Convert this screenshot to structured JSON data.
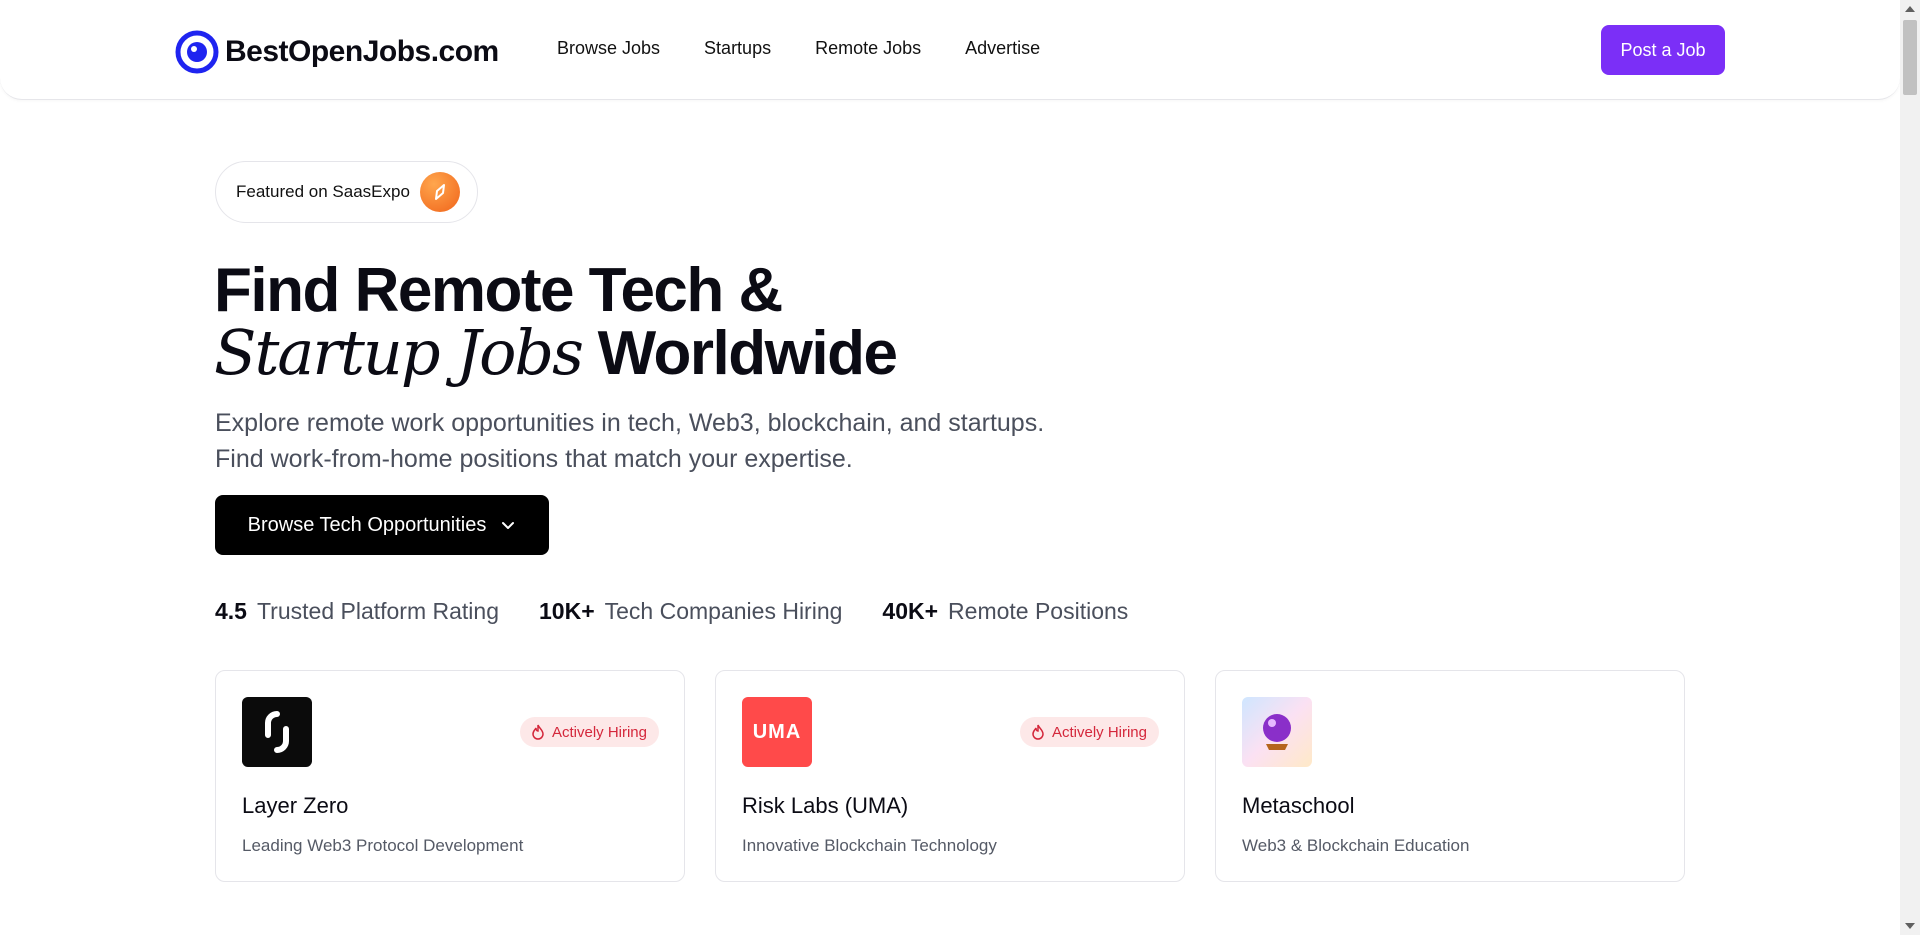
{
  "header": {
    "brand": "BestOpenJobs.com",
    "nav": [
      "Browse Jobs",
      "Startups",
      "Remote Jobs",
      "Advertise"
    ],
    "post_job": "Post a Job"
  },
  "featured": {
    "label": "Featured on SaasExpo"
  },
  "hero": {
    "title_line1": "Find Remote Tech &",
    "title_italic": "Startup Jobs",
    "title_line2_rest": " Worldwide",
    "subtitle_line1": "Explore remote work opportunities in tech, Web3, blockchain, and startups.",
    "subtitle_line2": "Find work-from-home positions that match your expertise.",
    "cta": "Browse Tech Opportunities"
  },
  "stats": [
    {
      "value": "4.5",
      "label": "Trusted Platform Rating"
    },
    {
      "value": "10K+",
      "label": "Tech Companies Hiring"
    },
    {
      "value": "40K+",
      "label": "Remote Positions"
    }
  ],
  "companies": [
    {
      "name": "Layer Zero",
      "description": "Leading Web3 Protocol Development",
      "badge": "Actively Hiring",
      "logo_color": "#0b0b0b"
    },
    {
      "name": "Risk Labs (UMA)",
      "description": "Innovative Blockchain Technology",
      "badge": "Actively Hiring",
      "logo_color": "#ff4a4a",
      "logo_text": "UMA"
    },
    {
      "name": "Metaschool",
      "description": "Web3 & Blockchain Education",
      "badge": "",
      "logo_color": "#f3e6f7"
    }
  ],
  "colors": {
    "accent": "#7b2ff7",
    "brand_blue": "#1f24f0",
    "badge_bg": "#fde8e8",
    "badge_text": "#d4273b"
  }
}
